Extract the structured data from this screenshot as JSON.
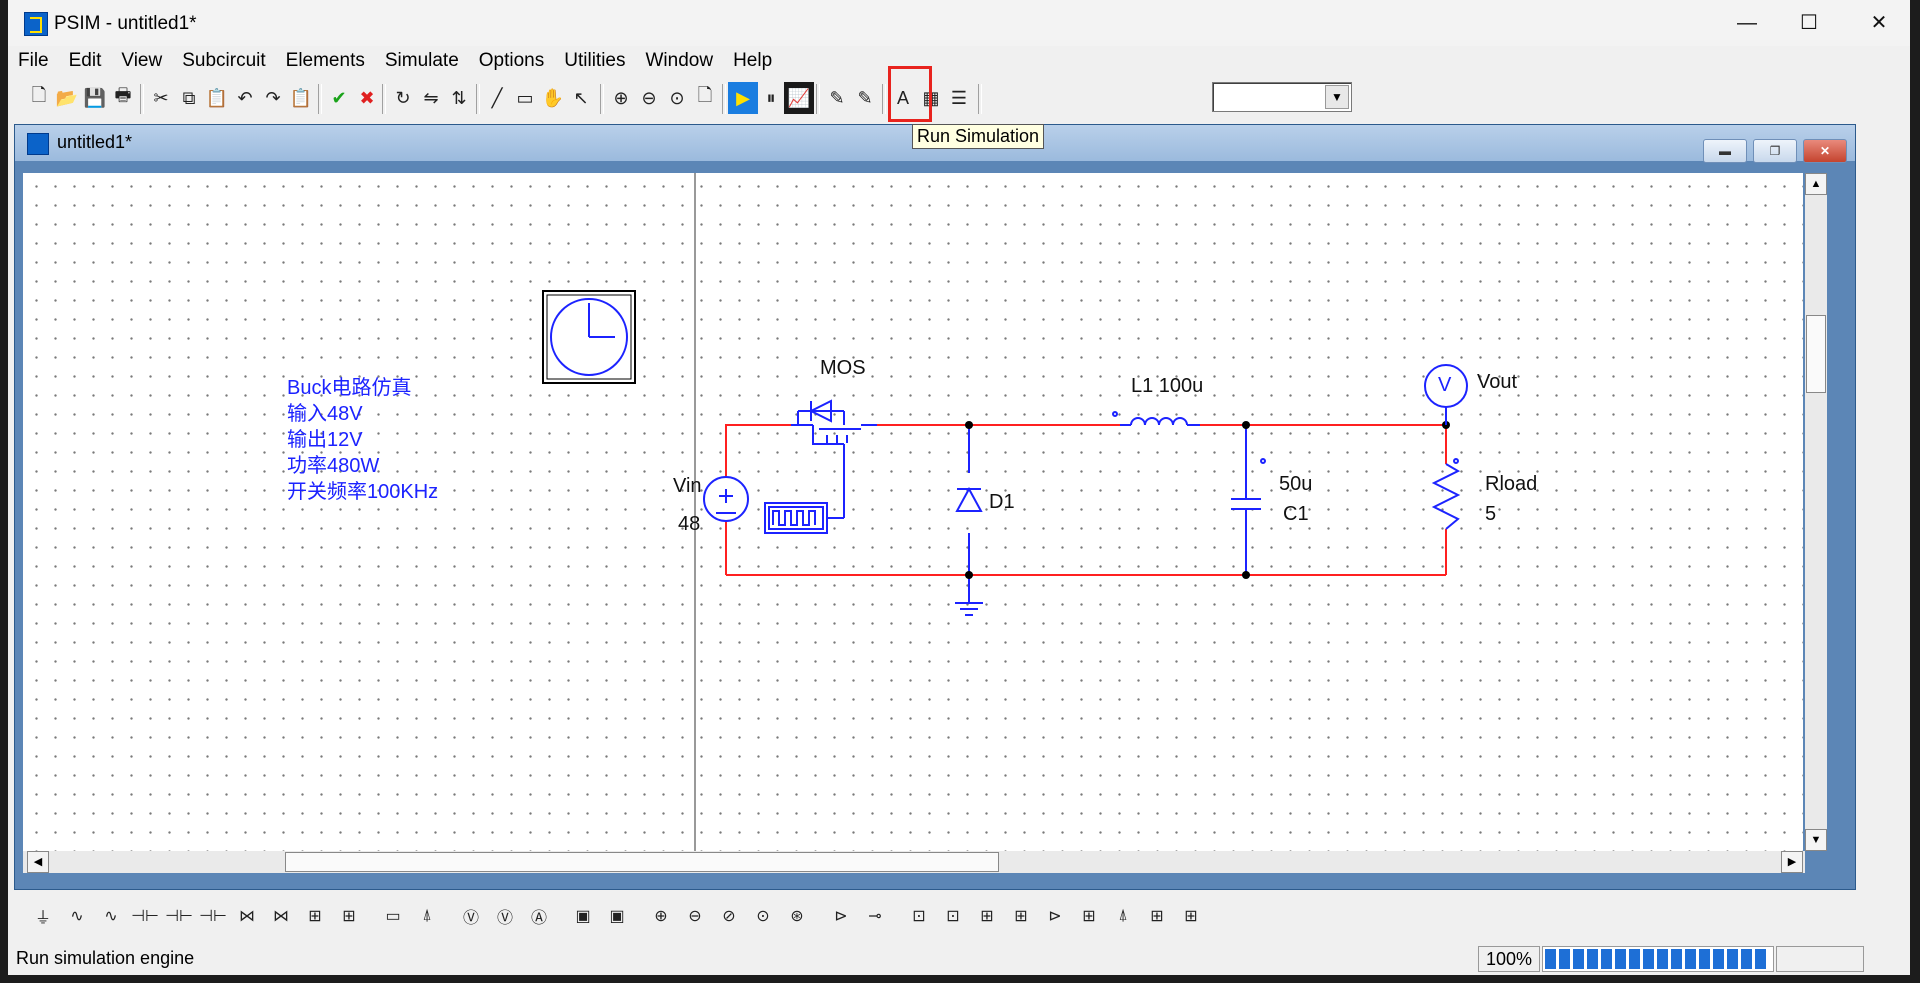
{
  "window": {
    "title": "PSIM - untitled1*",
    "minimize": "—",
    "maximize": "☐",
    "close": "✕"
  },
  "menu": [
    "File",
    "Edit",
    "View",
    "Subcircuit",
    "Elements",
    "Simulate",
    "Options",
    "Utilities",
    "Window",
    "Help"
  ],
  "toolbar": {
    "buttons": [
      {
        "name": "new-icon",
        "glyph": "🗋"
      },
      {
        "name": "open-icon",
        "glyph": "📂"
      },
      {
        "name": "save-icon",
        "glyph": "💾"
      },
      {
        "name": "print-icon",
        "glyph": "🖶"
      },
      {
        "name": "cut-icon",
        "glyph": "✂"
      },
      {
        "name": "copy-icon",
        "glyph": "⧉"
      },
      {
        "name": "paste-icon",
        "glyph": "📋"
      },
      {
        "name": "undo-icon",
        "glyph": "↶"
      },
      {
        "name": "redo-icon",
        "glyph": "↷"
      },
      {
        "name": "escape-icon",
        "glyph": "📋"
      },
      {
        "name": "check-icon",
        "glyph": "✔"
      },
      {
        "name": "cancel-icon",
        "glyph": "✖"
      },
      {
        "name": "rotate-icon",
        "glyph": "↻"
      },
      {
        "name": "flip-lr-icon",
        "glyph": "⇋"
      },
      {
        "name": "flip-tb-icon",
        "glyph": "⇅"
      },
      {
        "name": "wire-icon",
        "glyph": "╱"
      },
      {
        "name": "label-icon",
        "glyph": "▭"
      },
      {
        "name": "pan-hand-icon",
        "glyph": "✋"
      },
      {
        "name": "select-arrow-icon",
        "glyph": "↖"
      },
      {
        "name": "zoom-in-icon",
        "glyph": "⊕"
      },
      {
        "name": "zoom-out-icon",
        "glyph": "⊖"
      },
      {
        "name": "zoom-fit-icon",
        "glyph": "⊙"
      },
      {
        "name": "page-icon",
        "glyph": "🗋"
      },
      {
        "name": "run-simulation-icon",
        "glyph": "▶"
      },
      {
        "name": "pause-icon",
        "glyph": "⏸"
      },
      {
        "name": "simview-icon",
        "glyph": "📈"
      },
      {
        "name": "voltage-probe-icon",
        "glyph": "✎"
      },
      {
        "name": "current-probe-icon",
        "glyph": "✎"
      },
      {
        "name": "text-icon",
        "glyph": "A"
      },
      {
        "name": "color-icon",
        "glyph": "▦"
      },
      {
        "name": "library-icon",
        "glyph": "☰"
      }
    ],
    "combo_value": ""
  },
  "tooltip": "Run Simulation",
  "child_window": {
    "title": "untitled1*"
  },
  "note_lines": [
    "Buck电路仿真",
    "输入48V",
    "输出12V",
    "功率480W",
    "开关频率100KHz"
  ],
  "circuit": {
    "switch_label": "MOS",
    "source_name": "Vin",
    "source_value": "48",
    "diode_label": "D1",
    "inductor_label": "L1  100u",
    "cap_value": "50u",
    "cap_label": "C1",
    "meter_glyph": "V",
    "meter_label": "Vout",
    "load_label": "Rload",
    "load_value": "5",
    "source_plus": "+"
  },
  "element_bar": [
    "⏚",
    "∿",
    "∿",
    "⊣⊢",
    "⊣⊢",
    "⊣⊢",
    "⋈",
    "⋈",
    "⊞",
    "⊞",
    "▭",
    "⍋",
    "Ⓥ",
    "Ⓥ",
    "Ⓐ",
    "▣",
    "▣",
    "⊕",
    "⊖",
    "⊘",
    "⊙",
    "⊛",
    "⊳",
    "⊸",
    "⊡",
    "⊡",
    "⊞",
    "⊞",
    "⊳",
    "⊞",
    "⍋",
    "⊞",
    "⊞"
  ],
  "status": {
    "text": "Run simulation engine",
    "zoom": "100%",
    "progress": 0.98
  }
}
